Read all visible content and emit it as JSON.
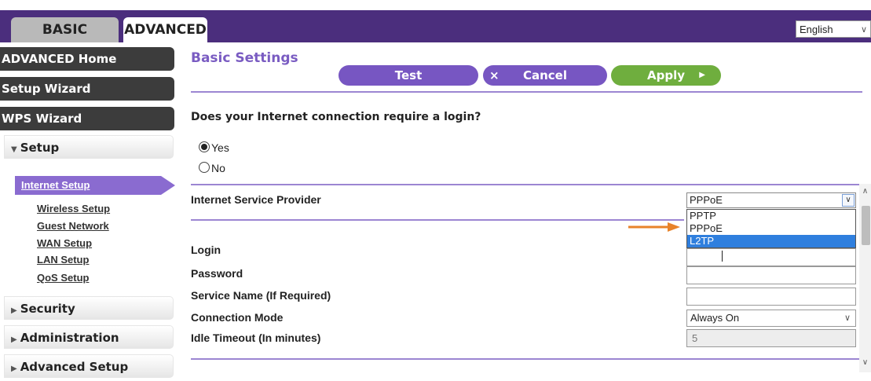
{
  "tabs": {
    "basic": "BASIC",
    "advanced": "ADVANCED"
  },
  "language": "English",
  "sidebar": {
    "advanced_home": "ADVANCED Home",
    "setup_wizard": "Setup Wizard",
    "wps_wizard": "WPS Wizard",
    "setup": "Setup",
    "setup_items": [
      "Internet Setup",
      "Wireless Setup",
      "Guest Network",
      "WAN Setup",
      "LAN Setup",
      "QoS Setup"
    ],
    "security": "Security",
    "administration": "Administration",
    "advanced_setup": "Advanced Setup"
  },
  "main": {
    "title": "Basic Settings",
    "buttons": {
      "test": "Test",
      "cancel": "Cancel",
      "apply": "Apply"
    },
    "question": "Does your Internet connection require a login?",
    "options": {
      "yes": "Yes",
      "no": "No"
    },
    "isp_label": "Internet Service Provider",
    "isp_value": "PPPoE",
    "isp_options": [
      "PPTP",
      "PPPoE",
      "L2TP"
    ],
    "login_label": "Login",
    "password_label": "Password",
    "service_name_label": "Service Name (If Required)",
    "connection_mode_label": "Connection Mode",
    "connection_mode_value": "Always On",
    "idle_timeout_label": "Idle Timeout (In minutes)",
    "idle_timeout_value": "5"
  },
  "colors": {
    "header_band": "#4b2e7d",
    "accent_purple": "#7756c2",
    "apply_green": "#6fae3e",
    "selection_blue": "#2f7fde",
    "annotation_orange": "#e8832a"
  }
}
